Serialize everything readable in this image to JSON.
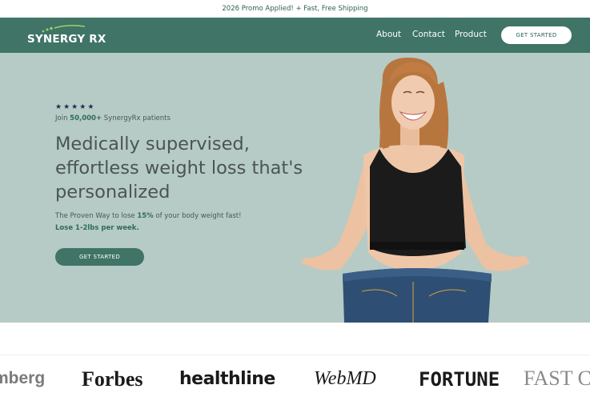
{
  "promo": {
    "text": "2026 Promo Applied! + Fast, Free Shipping"
  },
  "header": {
    "logo_text": "SYNERGY RX",
    "nav": {
      "about": "About",
      "contact": "Contact",
      "product": "Product"
    },
    "cta": "GET STARTED"
  },
  "hero": {
    "stars": [
      "★",
      "★",
      "★",
      "★",
      "★"
    ],
    "join_prefix": "Join ",
    "join_count": "50,000+",
    "join_suffix": " SynergyRx patients",
    "headline": "Medically supervised, effortless weight loss that's personalized",
    "sub_prefix": "The Proven Way to lose ",
    "sub_percent": "15%",
    "sub_suffix": " of your body weight fast!",
    "rate": "Lose 1-2lbs per week.",
    "cta": "GET STARTED"
  },
  "press": {
    "logos": [
      "mberg",
      "Forbes",
      "healthline",
      "WebMD",
      "FORTUNE",
      "FAST C"
    ]
  },
  "colors": {
    "brand_green": "#3f7466",
    "hero_bg": "#b6cbc5",
    "accent_text": "#2f6b5c",
    "star": "#1f2f57"
  }
}
